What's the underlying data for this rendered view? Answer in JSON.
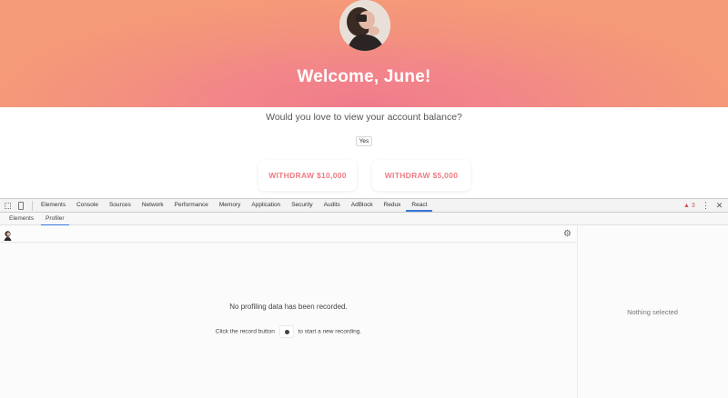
{
  "app": {
    "welcome": "Welcome, June!",
    "question": "Would you love to view your account balance?",
    "yes_label": "Yes",
    "withdraw_buttons": [
      "WITHDRAW $10,000",
      "WITHDRAW $5,000"
    ],
    "colors": {
      "hero_start": "#f59a78",
      "hero_center": "#f07b8a",
      "withdraw_text": "#ee7b82"
    }
  },
  "devtools": {
    "tabs": [
      "Elements",
      "Console",
      "Sources",
      "Network",
      "Performance",
      "Memory",
      "Application",
      "Security",
      "Audits",
      "AdBlock",
      "Redux",
      "React"
    ],
    "active_tab": "React",
    "warning_count": "3",
    "subtabs": [
      "Elements",
      "Profiler"
    ],
    "active_subtab": "Profiler",
    "empty_message": "No profiling data has been recorded.",
    "hint_before": "Click the record button",
    "hint_after": "to start a new recording.",
    "nothing_selected": "Nothing selected",
    "icons": [
      "inspect-icon",
      "device-toggle-icon",
      "warning-icon",
      "more-icon",
      "close-icon",
      "record-icon",
      "gear-icon"
    ],
    "accent": "#3879d9"
  }
}
